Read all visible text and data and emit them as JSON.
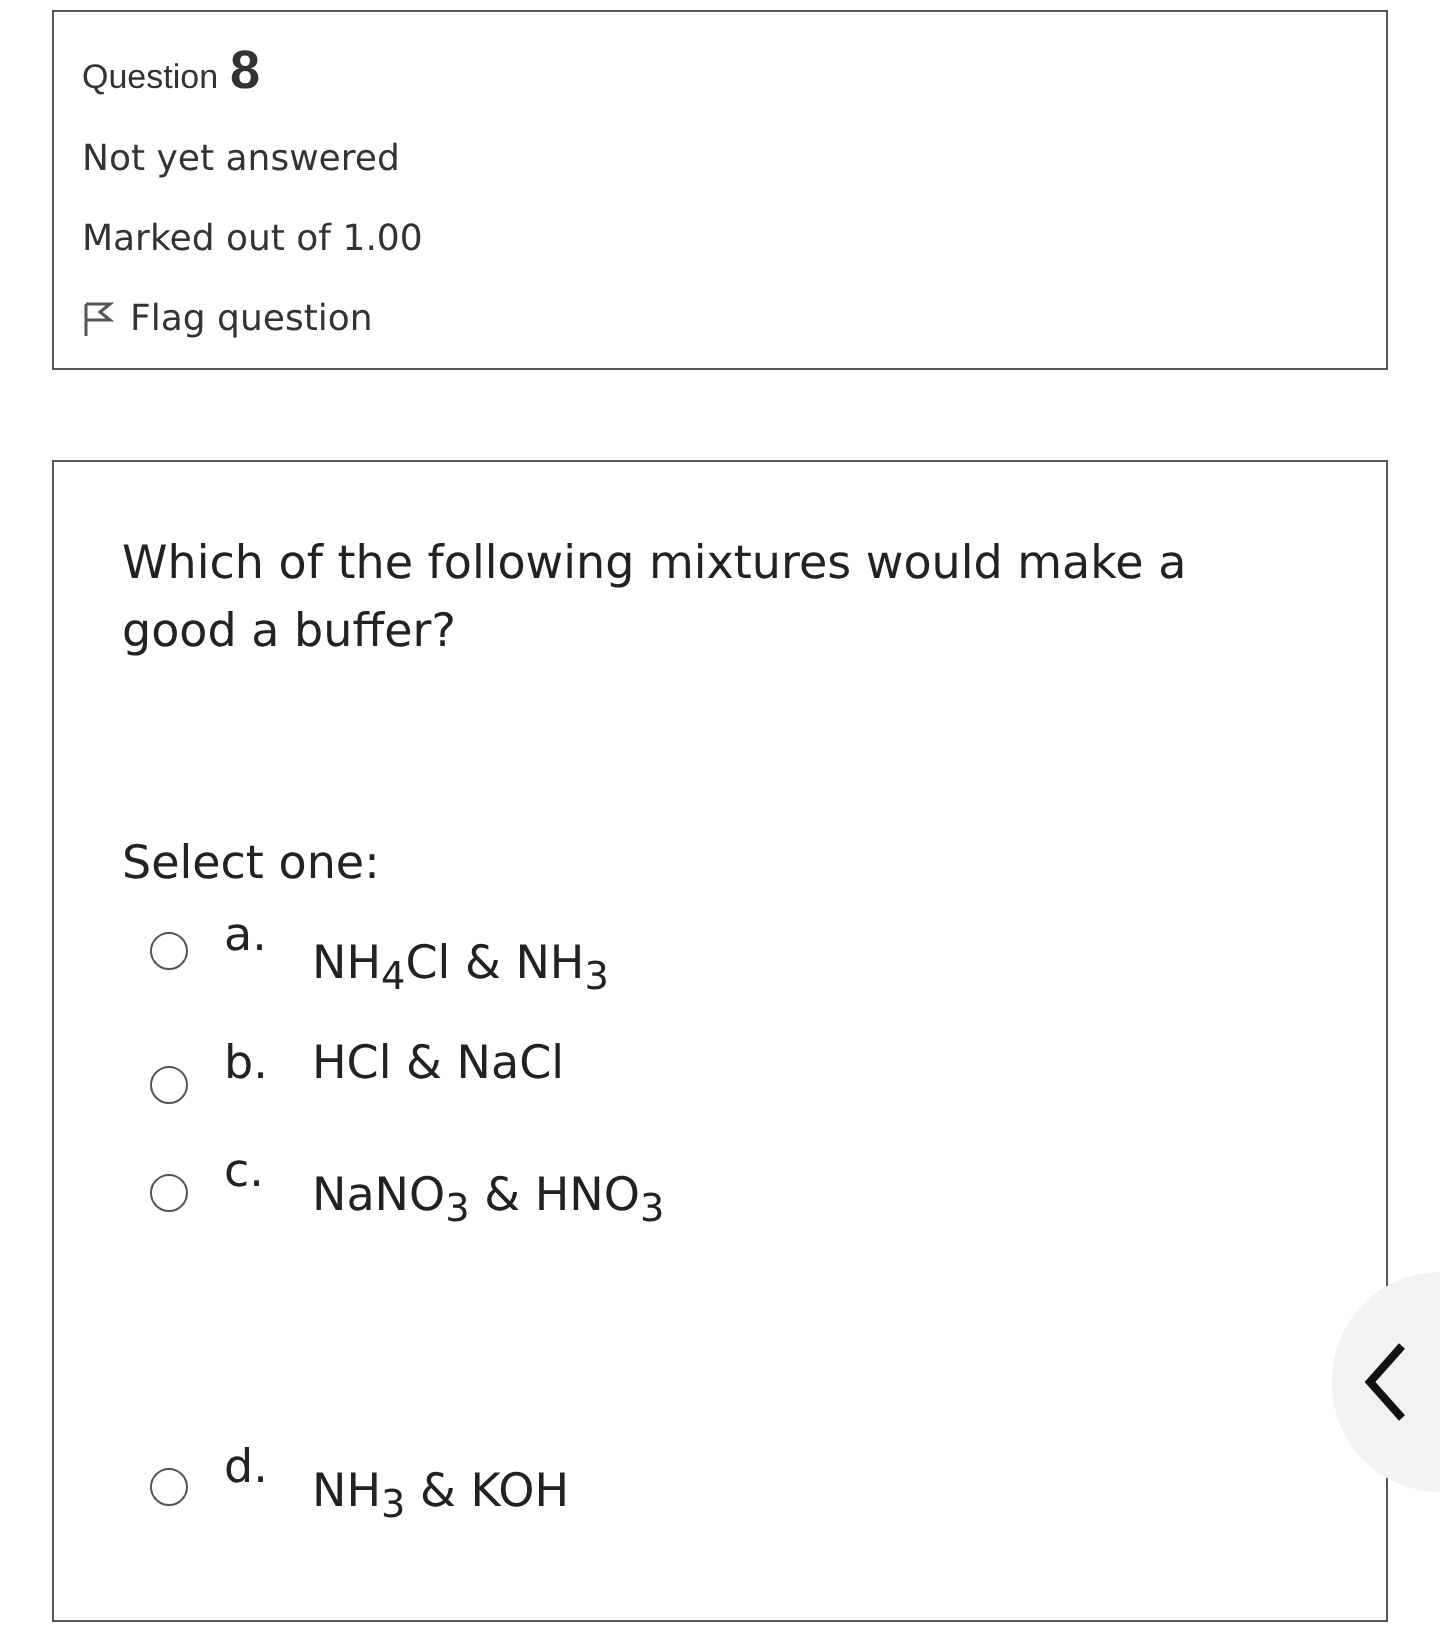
{
  "info": {
    "label": "Question",
    "number": "8",
    "status": "Not yet answered",
    "marks": "Marked out of 1.00",
    "flag": {
      "label": "Flag question",
      "flagged": false
    }
  },
  "question": {
    "text": "Which of the following mixtures would make a good a buffer?",
    "prompt": "Select one:",
    "options": [
      {
        "letter": "a.",
        "text": "NH$_{4}$Cl & NH$_{3}$",
        "selected": false
      },
      {
        "letter": "b.",
        "text": "HCl & NaCl",
        "selected": false
      },
      {
        "letter": "c.",
        "text": "NaNO$_{3}$ & HNO$_{3}$",
        "selected": false
      },
      {
        "letter": "d.",
        "text": "NH$_{3}$ & KOH",
        "selected": false
      }
    ]
  }
}
